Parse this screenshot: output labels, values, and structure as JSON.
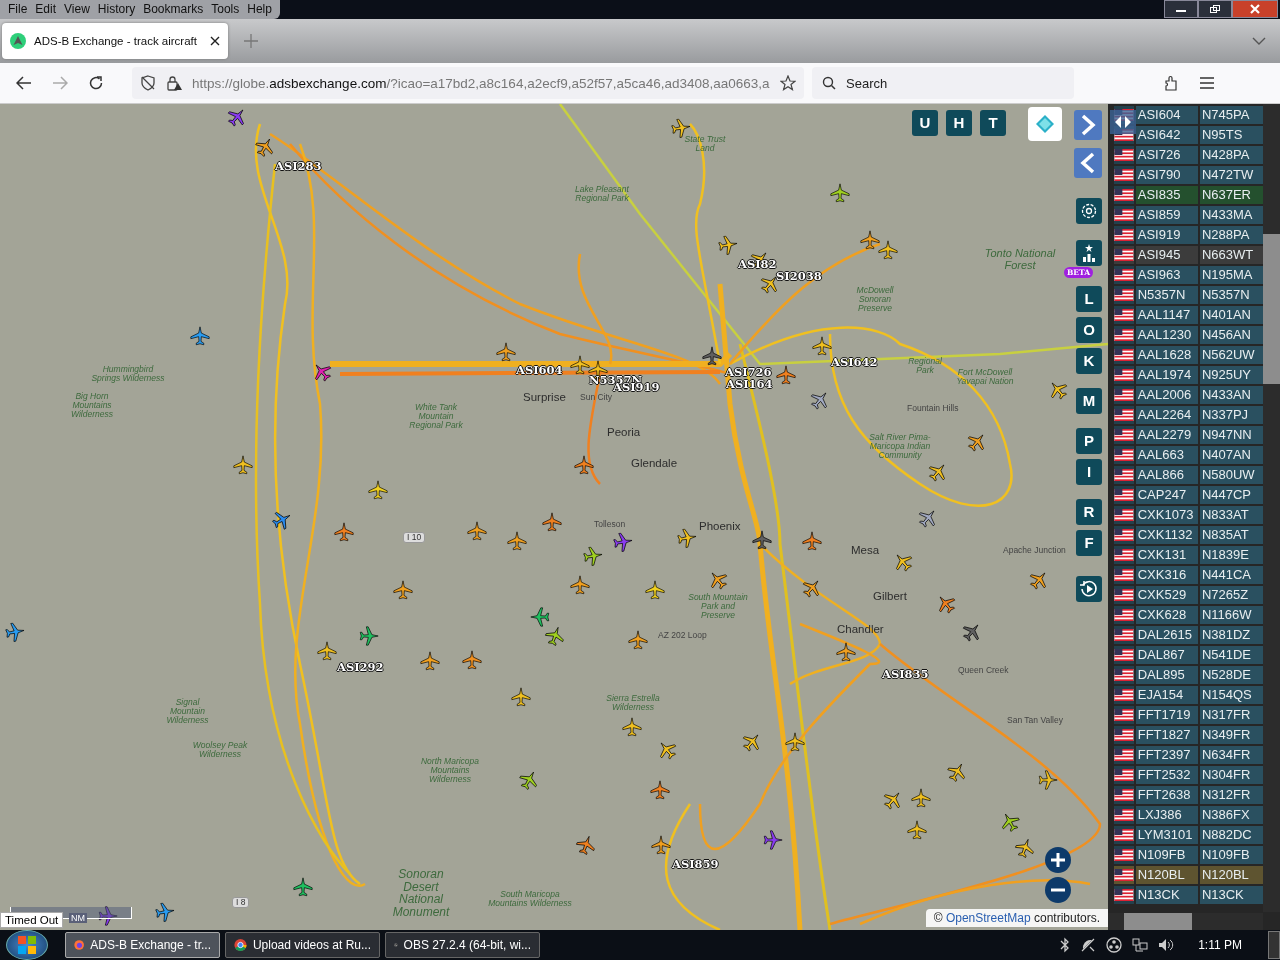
{
  "browser": {
    "menu": [
      "File",
      "Edit",
      "View",
      "History",
      "Bookmarks",
      "Tools",
      "Help"
    ],
    "tab": {
      "title": "ADS-B Exchange - track aircraft",
      "selected": true
    },
    "address": {
      "prefix": "https://globe.",
      "domain": "adsbexchange.com",
      "rest": "/?icao=a17bd2,a8c164,a2ecf9,a52f57,a5ca46,ad3408,aa0663,a"
    },
    "search": {
      "placeholder": "Search"
    }
  },
  "map": {
    "top_buttons": [
      "U",
      "H",
      "T"
    ],
    "side_buttons": [
      "L",
      "O",
      "K",
      "M",
      "P",
      "I",
      "R",
      "F"
    ],
    "beta": "BETA",
    "aircraft_labels": [
      "ASI283",
      "ASI82",
      "SI2038",
      "ASI642",
      "ASI604",
      "N5357N",
      "ASI726",
      "ASI919",
      "ASI164",
      "ASI292",
      "ASI835",
      "ASI859"
    ],
    "place_labels": [
      "Surprise",
      "Sun City",
      "Peoria",
      "Glendale",
      "Tolleson",
      "Phoenix",
      "Mesa",
      "Gilbert",
      "Chandler",
      "Tonto National Forest",
      "Hummingbird Springs Wilderness",
      "Big Horn Mountains Wilderness",
      "White Tank Mountain Regional Park",
      "Signal Mountain Wilderness",
      "Woolsey Peak Wilderness",
      "North Maricopa Mountains Wilderness",
      "Sonoran Desert National Monument",
      "South Maricopa Mountains Wilderness",
      "Sierra Estrella Wilderness",
      "South Mountain Park and Preserve",
      "Salt River Pima-Maricopa Indian Community",
      "Fort McDowell Yavapai Nation",
      "Fountain Hills",
      "Apache Junction",
      "Queen Creek",
      "San Tan Valley",
      "Lake Pleasant Regional Park",
      "State Trust Land",
      "AZ 202 Loop",
      "McDowell Sonoran Preserve",
      "Regional Park",
      "I 10",
      "I 8"
    ],
    "scale": "NM",
    "tooltip": "Timed Out",
    "attribution": {
      "symbol": "©",
      "link": "OpenStreetMap",
      "text": "contributors."
    }
  },
  "aircraft_list": [
    {
      "callsign": "ASI604",
      "registration": "N745PA",
      "selected": false,
      "hovered": false,
      "marked": false
    },
    {
      "callsign": "ASI642",
      "registration": "N95TS",
      "selected": false,
      "hovered": false,
      "marked": false
    },
    {
      "callsign": "ASI726",
      "registration": "N428PA",
      "selected": false,
      "hovered": false,
      "marked": false
    },
    {
      "callsign": "ASI790",
      "registration": "N472TW",
      "selected": false,
      "hovered": false,
      "marked": false
    },
    {
      "callsign": "ASI835",
      "registration": "N637ER",
      "selected": true,
      "hovered": false,
      "marked": false
    },
    {
      "callsign": "ASI859",
      "registration": "N433MA",
      "selected": false,
      "hovered": false,
      "marked": false
    },
    {
      "callsign": "ASI919",
      "registration": "N288PA",
      "selected": false,
      "hovered": false,
      "marked": false
    },
    {
      "callsign": "ASI945",
      "registration": "N663WT",
      "selected": false,
      "hovered": true,
      "marked": false
    },
    {
      "callsign": "ASI963",
      "registration": "N195MA",
      "selected": false,
      "hovered": false,
      "marked": false
    },
    {
      "callsign": "N5357N",
      "registration": "N5357N",
      "selected": false,
      "hovered": false,
      "marked": false
    },
    {
      "callsign": "AAL1147",
      "registration": "N401AN",
      "selected": false,
      "hovered": false,
      "marked": false
    },
    {
      "callsign": "AAL1230",
      "registration": "N456AN",
      "selected": false,
      "hovered": false,
      "marked": false
    },
    {
      "callsign": "AAL1628",
      "registration": "N562UW",
      "selected": false,
      "hovered": false,
      "marked": false
    },
    {
      "callsign": "AAL1974",
      "registration": "N925UY",
      "selected": false,
      "hovered": false,
      "marked": false
    },
    {
      "callsign": "AAL2006",
      "registration": "N433AN",
      "selected": false,
      "hovered": false,
      "marked": false
    },
    {
      "callsign": "AAL2264",
      "registration": "N337PJ",
      "selected": false,
      "hovered": false,
      "marked": false
    },
    {
      "callsign": "AAL2279",
      "registration": "N947NN",
      "selected": false,
      "hovered": false,
      "marked": false
    },
    {
      "callsign": "AAL663",
      "registration": "N407AN",
      "selected": false,
      "hovered": false,
      "marked": false
    },
    {
      "callsign": "AAL866",
      "registration": "N580UW",
      "selected": false,
      "hovered": false,
      "marked": false
    },
    {
      "callsign": "CAP247",
      "registration": "N447CP",
      "selected": false,
      "hovered": false,
      "marked": false
    },
    {
      "callsign": "CXK1073",
      "registration": "N833AT",
      "selected": false,
      "hovered": false,
      "marked": false
    },
    {
      "callsign": "CXK1132",
      "registration": "N835AT",
      "selected": false,
      "hovered": false,
      "marked": false
    },
    {
      "callsign": "CXK131",
      "registration": "N1839E",
      "selected": false,
      "hovered": false,
      "marked": false
    },
    {
      "callsign": "CXK316",
      "registration": "N441CA",
      "selected": false,
      "hovered": false,
      "marked": false
    },
    {
      "callsign": "CXK529",
      "registration": "N7265Z",
      "selected": false,
      "hovered": false,
      "marked": false
    },
    {
      "callsign": "CXK628",
      "registration": "N1166W",
      "selected": false,
      "hovered": false,
      "marked": false
    },
    {
      "callsign": "DAL2615",
      "registration": "N381DZ",
      "selected": false,
      "hovered": false,
      "marked": false
    },
    {
      "callsign": "DAL867",
      "registration": "N541DE",
      "selected": false,
      "hovered": false,
      "marked": false
    },
    {
      "callsign": "DAL895",
      "registration": "N528DE",
      "selected": false,
      "hovered": false,
      "marked": false
    },
    {
      "callsign": "EJA154",
      "registration": "N154QS",
      "selected": false,
      "hovered": false,
      "marked": false
    },
    {
      "callsign": "FFT1719",
      "registration": "N317FR",
      "selected": false,
      "hovered": false,
      "marked": false
    },
    {
      "callsign": "FFT1827",
      "registration": "N349FR",
      "selected": false,
      "hovered": false,
      "marked": false
    },
    {
      "callsign": "FFT2397",
      "registration": "N634FR",
      "selected": false,
      "hovered": false,
      "marked": false
    },
    {
      "callsign": "FFT2532",
      "registration": "N304FR",
      "selected": false,
      "hovered": false,
      "marked": false
    },
    {
      "callsign": "FFT2638",
      "registration": "N312FR",
      "selected": false,
      "hovered": false,
      "marked": false
    },
    {
      "callsign": "LXJ386",
      "registration": "N386FX",
      "selected": false,
      "hovered": false,
      "marked": false
    },
    {
      "callsign": "LYM3101",
      "registration": "N882DC",
      "selected": false,
      "hovered": false,
      "marked": false
    },
    {
      "callsign": "N109FB",
      "registration": "N109FB",
      "selected": false,
      "hovered": false,
      "marked": false
    },
    {
      "callsign": "N120BL",
      "registration": "N120BL",
      "selected": false,
      "hovered": false,
      "marked": true
    },
    {
      "callsign": "N13CK",
      "registration": "N13CK",
      "selected": false,
      "hovered": false,
      "marked": false
    }
  ],
  "taskbar": {
    "tasks": [
      {
        "title": "ADS-B Exchange - tr...",
        "kind": "firefox",
        "selected": true
      },
      {
        "title": "Upload videos at Ru...",
        "kind": "chrome",
        "selected": false
      },
      {
        "title": "OBS 27.2.4 (64-bit, wi...",
        "kind": "obs",
        "selected": false
      }
    ],
    "clock": "1:11 PM"
  }
}
